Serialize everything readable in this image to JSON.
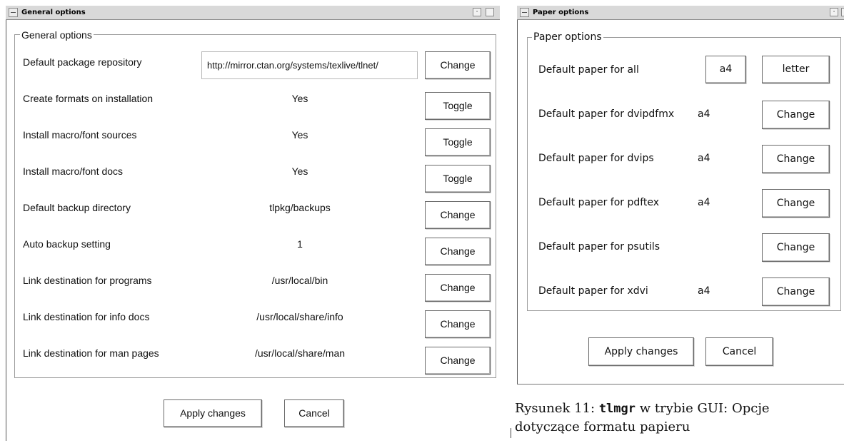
{
  "general_window": {
    "title": "General options",
    "group_label": "General options",
    "rows": [
      {
        "label": "Default package repository",
        "value": "http://mirror.ctan.org/systems/texlive/tlnet/",
        "button": "Change"
      },
      {
        "label": "Create formats on installation",
        "value": "Yes",
        "button": "Toggle"
      },
      {
        "label": "Install macro/font sources",
        "value": "Yes",
        "button": "Toggle"
      },
      {
        "label": "Install macro/font docs",
        "value": "Yes",
        "button": "Toggle"
      },
      {
        "label": "Default backup directory",
        "value": "tlpkg/backups",
        "button": "Change"
      },
      {
        "label": "Auto backup setting",
        "value": "1",
        "button": "Change"
      },
      {
        "label": "Link destination for programs",
        "value": "/usr/local/bin",
        "button": "Change"
      },
      {
        "label": "Link destination for info docs",
        "value": "/usr/local/share/info",
        "button": "Change"
      },
      {
        "label": "Link destination for man pages",
        "value": "/usr/local/share/man",
        "button": "Change"
      }
    ],
    "apply_label": "Apply changes",
    "cancel_label": "Cancel"
  },
  "paper_window": {
    "title": "Paper options",
    "group_label": "Paper options",
    "all_row": {
      "label": "Default paper for all",
      "a4_button": "a4",
      "letter_button": "letter"
    },
    "rows": [
      {
        "label": "Default paper for dvipdfmx",
        "value": "a4",
        "button": "Change"
      },
      {
        "label": "Default paper for dvips",
        "value": "a4",
        "button": "Change"
      },
      {
        "label": "Default paper for pdftex",
        "value": "a4",
        "button": "Change"
      },
      {
        "label": "Default paper for psutils",
        "value": "",
        "button": "Change"
      },
      {
        "label": "Default paper for xdvi",
        "value": "a4",
        "button": "Change"
      }
    ],
    "apply_label": "Apply changes",
    "cancel_label": "Cancel"
  },
  "caption": {
    "line1_prefix": "Rysunek 11: ",
    "line1_code": "tlmgr",
    "line1_suffix": " w trybie GUI: Opcje",
    "line2": "dotyczące formatu papieru"
  }
}
